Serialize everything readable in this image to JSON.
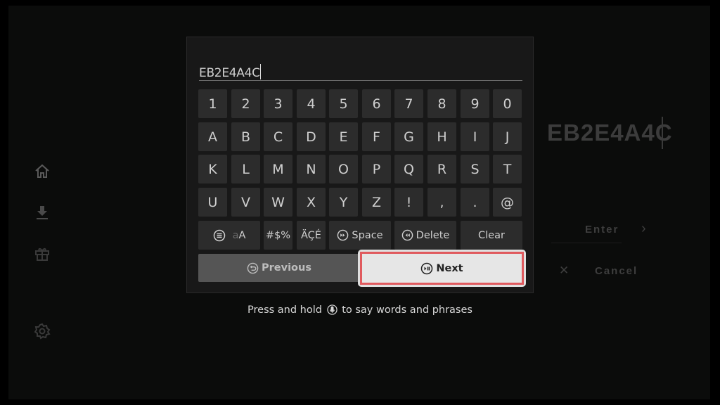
{
  "background": {
    "code_text": "EB2E4A4C",
    "enter_label": "Enter",
    "cancel_label": "Cancel",
    "icons": {
      "enter": "chevron-right-icon",
      "cancel": "close-icon"
    }
  },
  "sidebar": {
    "items": [
      {
        "name": "home",
        "icon": "home-icon"
      },
      {
        "name": "downloads",
        "icon": "download-icon"
      },
      {
        "name": "gifts",
        "icon": "gift-icon"
      },
      {
        "name": "settings",
        "icon": "gear-icon"
      }
    ]
  },
  "keyboard": {
    "input_value": "EB2E4A4C",
    "rows": [
      [
        "1",
        "2",
        "3",
        "4",
        "5",
        "6",
        "7",
        "8",
        "9",
        "0"
      ],
      [
        "A",
        "B",
        "C",
        "D",
        "E",
        "F",
        "G",
        "H",
        "I",
        "J"
      ],
      [
        "K",
        "L",
        "M",
        "N",
        "O",
        "P",
        "Q",
        "R",
        "S",
        "T"
      ],
      [
        "U",
        "V",
        "W",
        "X",
        "Y",
        "Z",
        "!",
        ",",
        ".",
        "@"
      ]
    ],
    "function_keys": {
      "case_label_lower": "a",
      "case_label_upper": "A",
      "symbols_label": "#$%",
      "accents_label": "ÄÇÉ",
      "space_label": "Space",
      "delete_label": "Delete",
      "clear_label": "Clear"
    },
    "previous_label": "Previous",
    "next_label": "Next",
    "focused_button": "Next",
    "focus_color": "#e05a5e"
  },
  "hint": {
    "before": "Press and hold",
    "after": "to say words and phrases",
    "icon": "microphone-icon"
  }
}
